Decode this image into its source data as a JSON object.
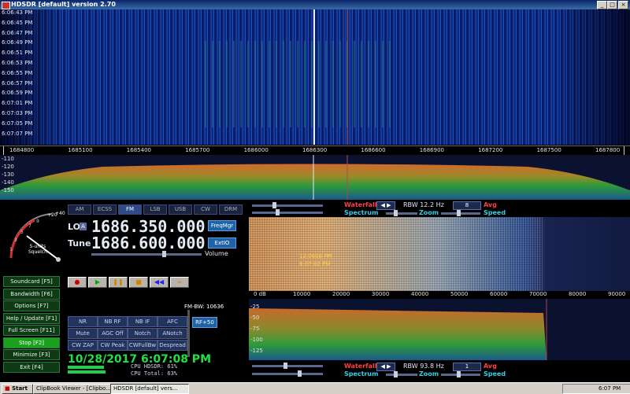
{
  "window": {
    "title": "HDSDR [default]  version 2.70"
  },
  "waterfall_times": [
    "6:06:43 PM",
    "6:06:45 PM",
    "6:06:47 PM",
    "6:06:49 PM",
    "6:06:51 PM",
    "6:06:53 PM",
    "6:06:55 PM",
    "6:06:57 PM",
    "6:06:59 PM",
    "6:07:01 PM",
    "6:07:03 PM",
    "6:07:05 PM",
    "6:07:07 PM"
  ],
  "freq_labels": [
    "1684800",
    "1685100",
    "1685400",
    "1685700",
    "1686000",
    "1686300",
    "1686600",
    "1686900",
    "1687200",
    "1687500",
    "1687800"
  ],
  "spectrum_db": [
    "-110",
    "-120",
    "-130",
    "-140",
    "-150"
  ],
  "smeter": {
    "scale": [
      "1",
      "3",
      "5",
      "7",
      "9",
      "+20",
      "+40"
    ],
    "label": "S-units\nSquelch"
  },
  "modes": [
    "AM",
    "ECSS",
    "FM",
    "LSB",
    "USB",
    "CW",
    "DRM"
  ],
  "active_mode": "FM",
  "lo": {
    "label": "LO",
    "tag": "A",
    "value": "1686.350.000"
  },
  "tune": {
    "label": "Tune",
    "value": "1686.600.000"
  },
  "volume_label": "Volume",
  "buttons": {
    "freqmgr": "FreqMgr",
    "extio": "ExtIO"
  },
  "side_buttons": [
    "Soundcard  [F5]",
    "Bandwidth  [F6]",
    "Options  [F7]",
    "Help / Update  [F1]",
    "Full Screen  [F11]",
    "Stop  [F2]",
    "Minimize  [F3]",
    "Exit  [F4]"
  ],
  "transport": [
    "record",
    "play",
    "pause",
    "stop",
    "rewind",
    "loop"
  ],
  "fm_bw": "FM-BW: 10636",
  "rf_btn": "RF+50",
  "dsp_row1": [
    "NR",
    "NB RF",
    "NB IF",
    "AFC"
  ],
  "dsp_row2": [
    "Mute",
    "AGC Off",
    "Notch",
    "ANotch"
  ],
  "dsp_row3": [
    "CW ZAP",
    "CW Peak",
    "CWFullBw",
    "Despread"
  ],
  "datetime": "10/28/2017 6:07:08 PM",
  "cpu": {
    "hdsdr": "CPU HDSDR:  61%",
    "total": "CPU Total:  63%",
    "hdsdr_pct": 61,
    "total_pct": 63
  },
  "top_controls": {
    "waterfall": "Waterfall",
    "rbw": "RBW 12.2 Hz",
    "rbw_sel": "8",
    "avg": "Avg",
    "spectrum": "Spectrum",
    "zoom": "Zoom",
    "speed": "Speed"
  },
  "bottom_controls": {
    "waterfall": "Waterfall",
    "rbw": "RBW 93.8 Hz",
    "rbw_sel": "1",
    "avg": "Avg",
    "spectrum": "Spectrum",
    "zoom": "Zoom",
    "speed": "Speed"
  },
  "audio_wf_note": [
    "12:0608 PM",
    "6:07:02 PM"
  ],
  "audio_freq": [
    "0 dB",
    "10000",
    "20000",
    "30000",
    "40000",
    "50000",
    "60000",
    "70000",
    "80000",
    "90000"
  ],
  "audio_db": [
    "-25",
    "-50",
    "-75",
    "-100",
    "-125"
  ],
  "taskbar": {
    "start": "Start",
    "items": [
      "ClipBook Viewer - [Clipbo...",
      "HDSDR [default] vers..."
    ],
    "clock": "6:07 PM"
  }
}
